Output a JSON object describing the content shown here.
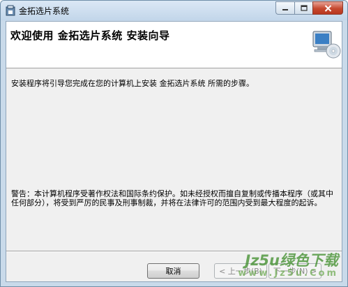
{
  "window": {
    "title": "金拓选片系统"
  },
  "banner": {
    "title": "欢迎使用  金拓选片系统  安装向导"
  },
  "body": {
    "intro": "安装程序将引导您完成在您的计算机上安装 金拓选片系统 所需的步骤。",
    "warning": "警告：本计算机程序受著作权法和国际条约保护。如未经授权而擅自复制或传播本程序（或其中任何部分），将受到严厉的民事及刑事制裁，并将在法律许可的范围内受到最大程度的起诉。"
  },
  "buttons": {
    "cancel": "取消",
    "prev": "< 上一步(B)",
    "next": "下一步(N) >"
  },
  "watermark": {
    "brand": "Jz5u绿色下载",
    "url": "www.Jz5u.Com"
  },
  "colors": {
    "titlebar": "#c9daea",
    "client": "#f0f0f0",
    "close_button": "#c5482f"
  }
}
